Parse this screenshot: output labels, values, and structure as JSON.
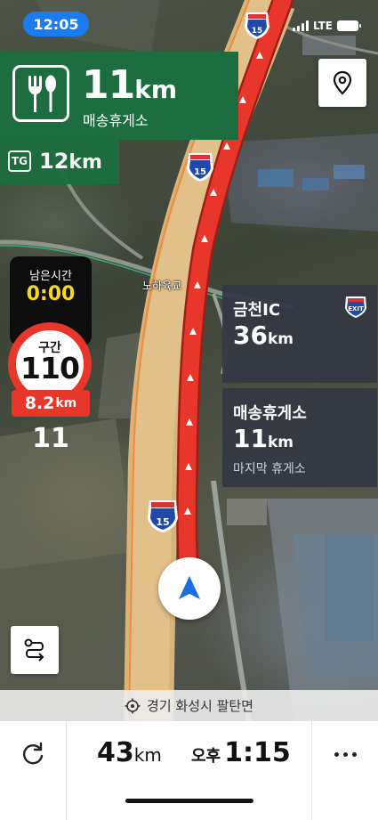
{
  "status_bar": {
    "time": "12:05",
    "network": "LTE"
  },
  "service_area": {
    "icon": "fork-spoon-icon",
    "distance_value": "11",
    "distance_unit": "km",
    "name": "매송휴게소"
  },
  "tollgate": {
    "badge": "TG",
    "distance_value": "12",
    "distance_unit": "km"
  },
  "location_button": {
    "icon": "map-pin-icon"
  },
  "section_speed": {
    "remaining_label": "남은시간",
    "remaining_time": "0:00",
    "sign_label": "구간",
    "limit": "110",
    "distance_value": "8.2",
    "distance_unit": "km",
    "average_speed": "11"
  },
  "map": {
    "place_label": "노하육교",
    "highway_number": "15",
    "colors": {
      "route": "#e8362b",
      "highway": "#d9b47a",
      "panel": "#1c6e3e"
    }
  },
  "info_cards": [
    {
      "title": "금천IC",
      "distance_value": "36",
      "distance_unit": "km",
      "icon": "exit-sign-icon",
      "subtitle": ""
    },
    {
      "title": "매송휴게소",
      "distance_value": "11",
      "distance_unit": "km",
      "subtitle": "마지막 휴게소"
    }
  ],
  "address_bar": {
    "icon": "crosshair-icon",
    "address": "경기 화성시 팔탄면"
  },
  "bottom_bar": {
    "refresh_icon": "refresh-icon",
    "remaining_distance_value": "43",
    "remaining_distance_unit": "km",
    "arrival_period": "오후",
    "arrival_time": "1:15",
    "more_icon": "more-icon"
  }
}
